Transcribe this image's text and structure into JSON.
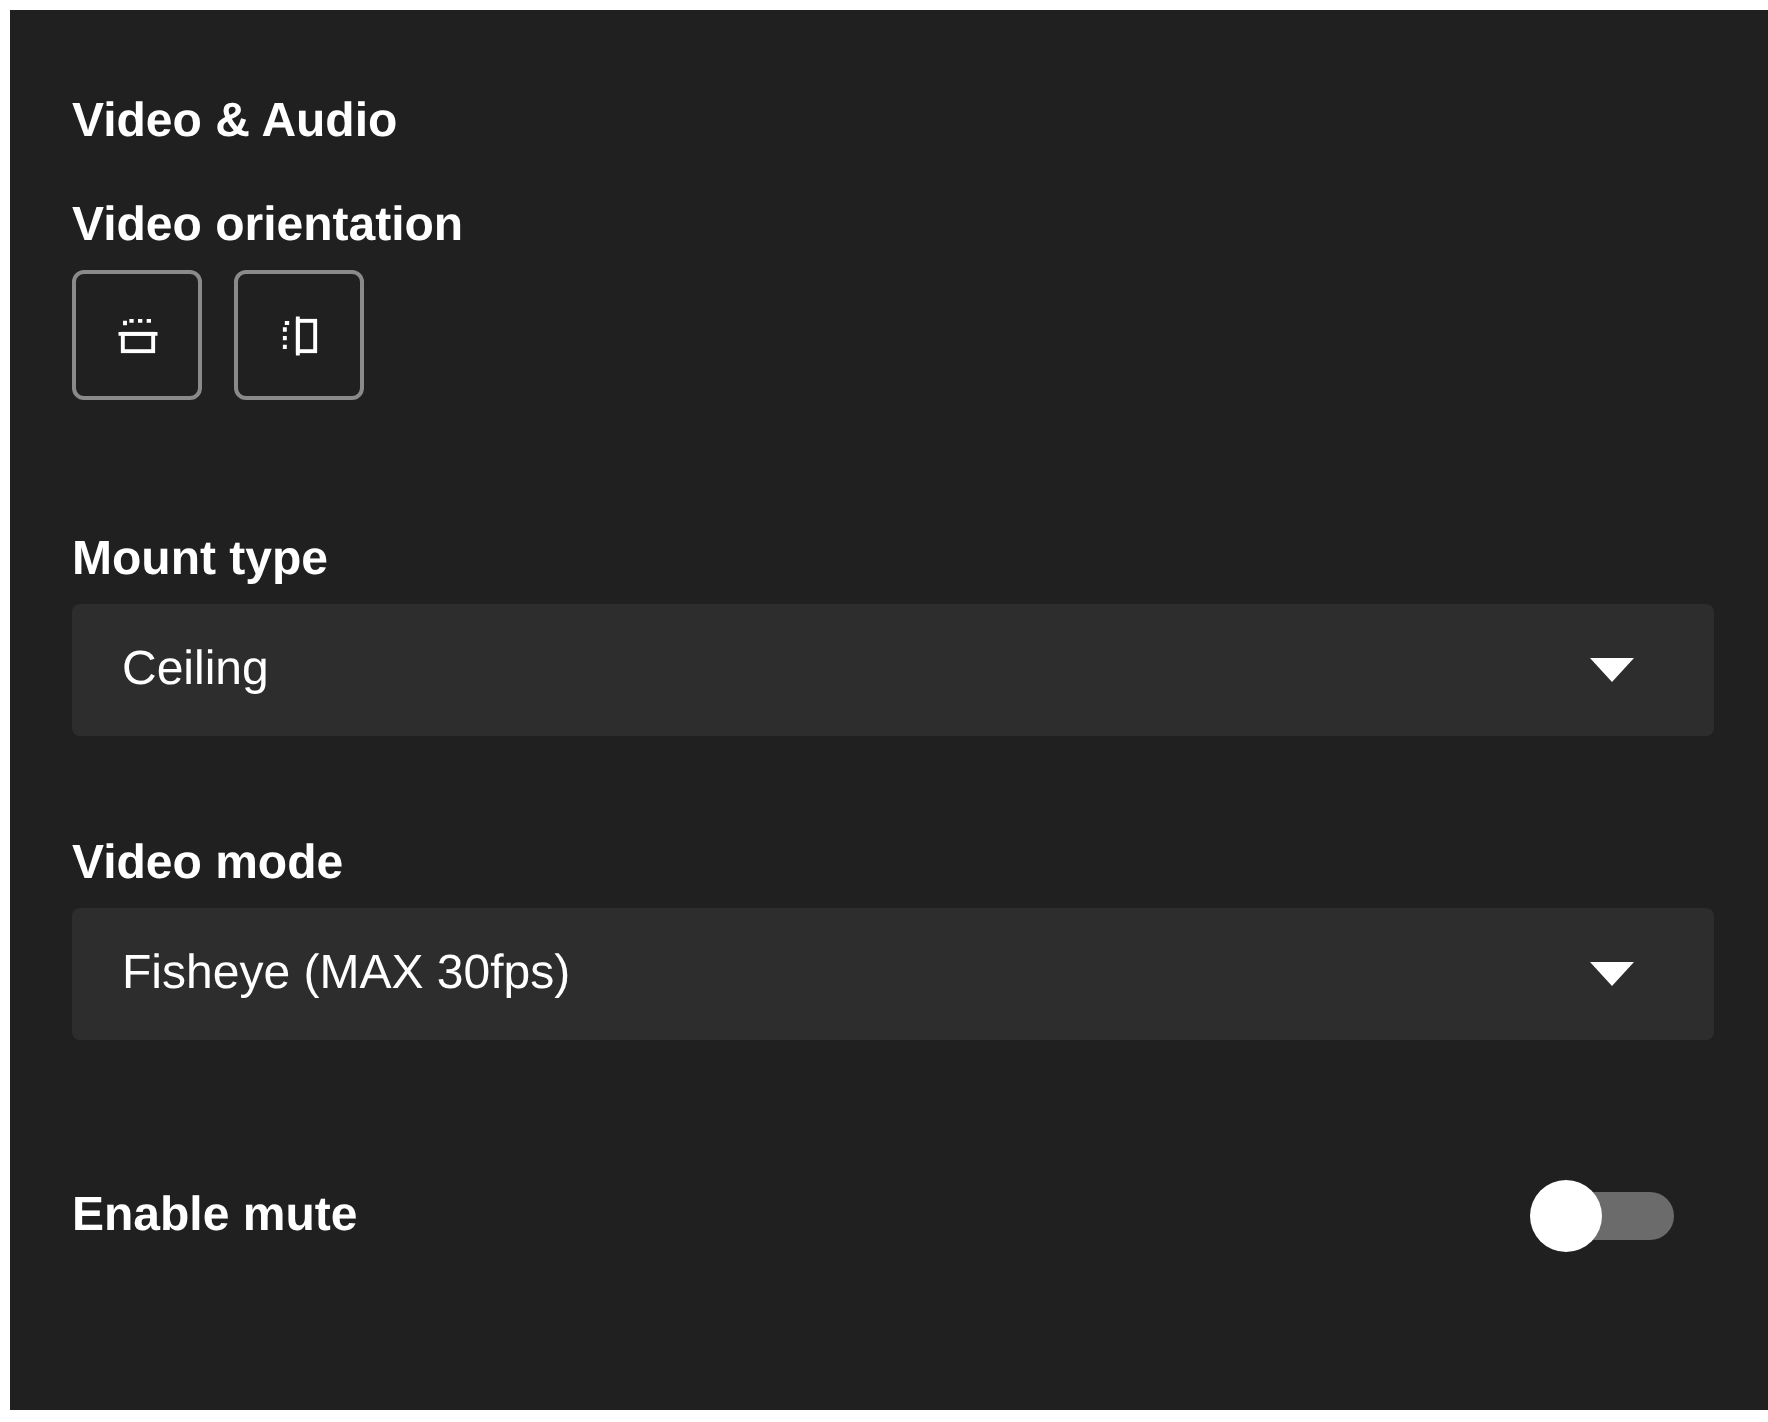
{
  "section_title": "Video & Audio",
  "orientation": {
    "label": "Video orientation",
    "buttons": [
      {
        "kind": "flip-vertical"
      },
      {
        "kind": "flip-horizontal"
      }
    ]
  },
  "dropdowns": [
    {
      "label": "Mount type",
      "value": "Ceiling"
    },
    {
      "label": "Video mode",
      "value": "Fisheye (MAX 30fps)"
    }
  ],
  "toggle": {
    "label": "Enable mute",
    "on": false
  }
}
